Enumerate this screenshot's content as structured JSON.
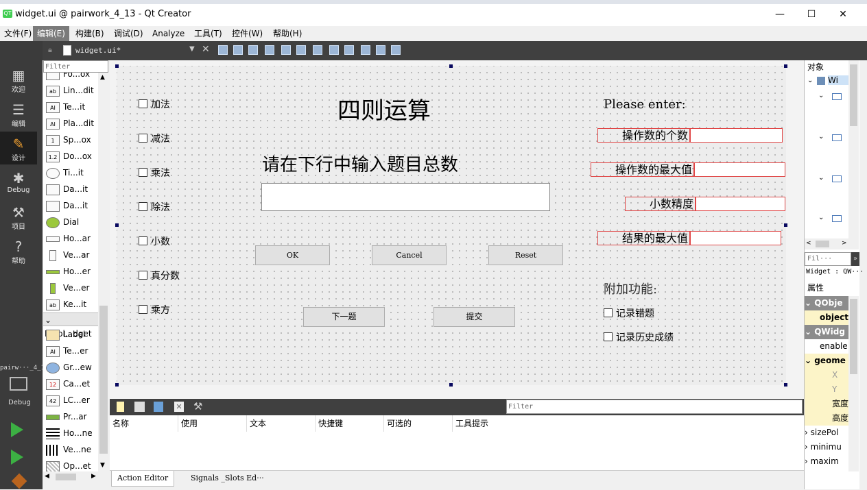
{
  "window": {
    "title": "widget.ui @ pairwork_4_13 - Qt Creator",
    "controls": [
      "—",
      "☐",
      "✕"
    ]
  },
  "menubar": [
    "文件(F)",
    "编辑(E)",
    "构建(B)",
    "调试(D)",
    "Analyze",
    "工具(T)",
    "控件(W)",
    "帮助(H)"
  ],
  "modes": [
    {
      "label": "欢迎",
      "icon": "grid-icon"
    },
    {
      "label": "编辑",
      "icon": "document-icon"
    },
    {
      "label": "设计",
      "icon": "pencil-icon"
    },
    {
      "label": "Debug",
      "icon": "bug-icon"
    },
    {
      "label": "项目",
      "icon": "wrench-icon"
    },
    {
      "label": "帮助",
      "icon": "help-icon"
    }
  ],
  "project_selector": {
    "name": "pairw···_4_13",
    "mode": "Debug"
  },
  "editor": {
    "tab": "widget.ui*"
  },
  "widget_box": {
    "filter_placeholder": "Filter",
    "items_input": [
      "Fo...ox",
      "Lin...dit",
      "Te...it",
      "Pla...dit",
      "Sp...ox",
      "Do...ox",
      "Ti...it",
      "Da...it",
      "Da...it",
      "Dial",
      "Ho...ar",
      "Ve...ar",
      "Ho...er",
      "Ve...er",
      "Ke...it"
    ],
    "category": "Displ...dget",
    "items_display": [
      "Label",
      "Te...er",
      "Gr...ew",
      "Ca...et",
      "LC...er",
      "Pr...ar",
      "Ho...ne",
      "Ve...ne",
      "Op...et"
    ]
  },
  "form": {
    "title": "四则运算",
    "checkboxes_left": [
      "加法",
      "减法",
      "乘法",
      "除法",
      "小数",
      "真分数",
      "乘方"
    ],
    "prompt": "请在下行中输入题目总数",
    "buttons": {
      "ok": "OK",
      "cancel": "Cancel",
      "reset": "Reset",
      "next": "下一题",
      "submit": "提交"
    },
    "please_enter": "Please enter:",
    "fields": [
      "操作数的个数",
      "操作数的最大值",
      "小数精度",
      "结果的最大值"
    ],
    "extra_title": "附加功能:",
    "checkboxes_right": [
      "记录错题",
      "记录历史成绩"
    ]
  },
  "action_editor": {
    "filter_placeholder": "Filter",
    "columns": [
      "名称",
      "使用",
      "文本",
      "快捷键",
      "可选的",
      "工具提示"
    ],
    "tabs": [
      "Action Editor",
      "Signals _Slots Ed···"
    ]
  },
  "inspector": {
    "object_header": "对象",
    "root_object": "Wi",
    "partial_right": "设",
    "filter_placeholder": "Fil···",
    "widget_label": "Widget : QW···",
    "property_header": "属性",
    "rows": [
      {
        "text": "QObje",
        "kind": "group"
      },
      {
        "text": "object",
        "kind": "bold"
      },
      {
        "text": "QWidg",
        "kind": "group"
      },
      {
        "text": "enable",
        "kind": "plain"
      },
      {
        "text": "geome",
        "kind": "boldexp"
      },
      {
        "text": "X",
        "kind": "sub"
      },
      {
        "text": "Y",
        "kind": "sub"
      },
      {
        "text": "宽度",
        "kind": "sub"
      },
      {
        "text": "高度",
        "kind": "sub"
      },
      {
        "text": "sizePol",
        "kind": "collapsed"
      },
      {
        "text": "minimu",
        "kind": "collapsed"
      },
      {
        "text": "maxim",
        "kind": "collapsed"
      }
    ]
  },
  "colors": {
    "dark_panel": "#404040",
    "mode_bar": "#3b3b3b",
    "field_border": "#e04646",
    "handle": "#0a0a60",
    "run_green": "#3cb043"
  }
}
